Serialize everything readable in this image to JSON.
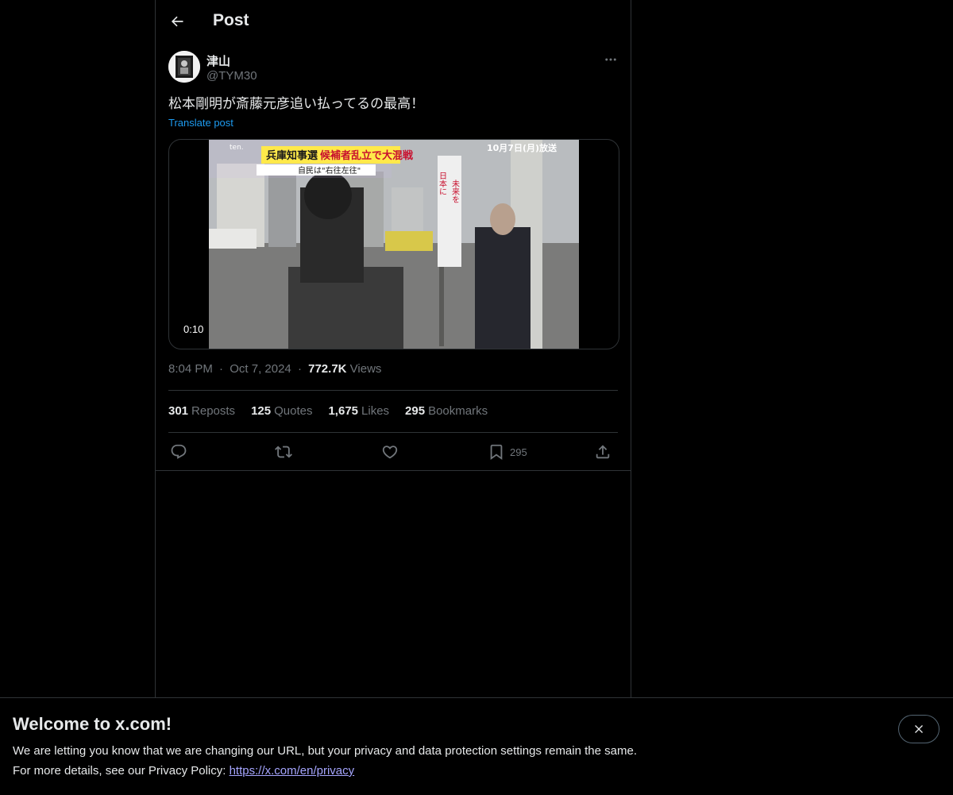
{
  "header": {
    "title": "Post",
    "back_icon": "arrow-left-icon"
  },
  "post": {
    "author": {
      "display_name": "津山",
      "handle": "@TYM30"
    },
    "text": "松本剛明が斎藤元彦追い払ってるの最高！",
    "translate_label": "Translate post",
    "media": {
      "duration": "0:10",
      "overlay_top_right": "10月7日(月)放送",
      "overlay_headline_a": "兵庫知事選",
      "overlay_headline_b": "候補者乱立で大混戦",
      "overlay_sub": "自民は\"右往左往\"",
      "overlay_logo": "ten.",
      "banner_text_a": "日本に",
      "banner_text_b": "未来を"
    },
    "time": "8:04 PM",
    "date": "Oct 7, 2024",
    "views_count": "772.7K",
    "views_label": "Views",
    "separator": "·",
    "stats": {
      "reposts_count": "301",
      "reposts_label": "Reposts",
      "quotes_count": "125",
      "quotes_label": "Quotes",
      "likes_count": "1,675",
      "likes_label": "Likes",
      "bookmarks_count": "295",
      "bookmarks_label": "Bookmarks"
    },
    "actions": {
      "bookmark_count": "295"
    }
  },
  "banner": {
    "title": "Welcome to x.com!",
    "line1": "We are letting you know that we are changing our URL, but your privacy and data protection settings remain the same.",
    "line2_prefix": "For more details, see our Privacy Policy: ",
    "link_text": "https://x.com/en/privacy"
  },
  "colors": {
    "background": "#000000",
    "text": "#e7e9ea",
    "muted": "#71767b",
    "accent": "#1d9bf0",
    "border": "#2f3336",
    "link": "#a6a6ff"
  }
}
